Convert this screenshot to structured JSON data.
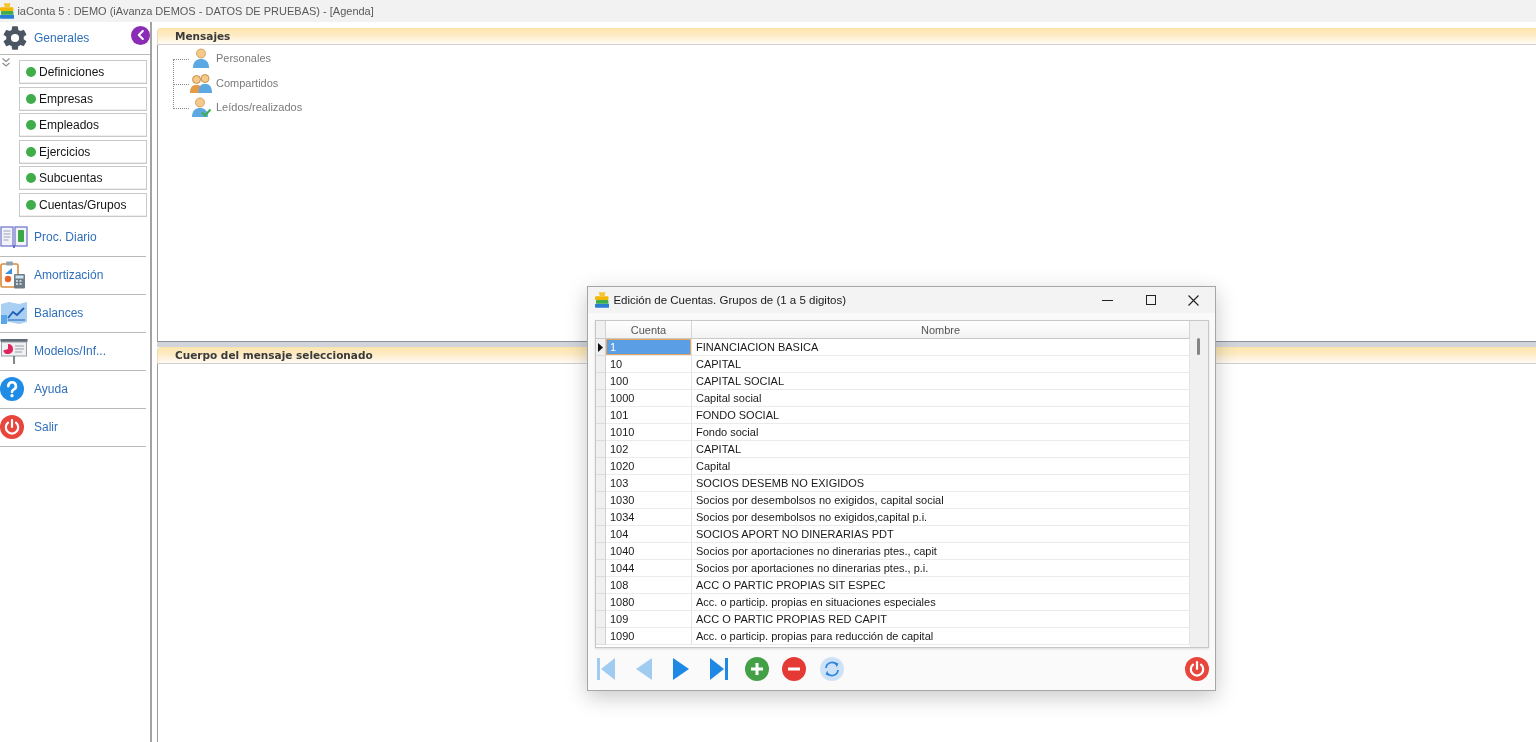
{
  "window": {
    "title": "iaConta 5 : DEMO (iAvanza DEMOS - DATOS DE PRUEBAS) - [Agenda]"
  },
  "sidebar": {
    "groups": [
      {
        "label": "Generales",
        "expanded": true,
        "children": [
          {
            "label": "Definiciones"
          },
          {
            "label": "Empresas"
          },
          {
            "label": "Empleados"
          },
          {
            "label": "Ejercicios"
          },
          {
            "label": "Subcuentas"
          },
          {
            "label": "Cuentas/Grupos"
          }
        ]
      },
      {
        "label": "Proc. Diario",
        "expanded": false
      },
      {
        "label": "Amortización",
        "expanded": false
      },
      {
        "label": "Balances",
        "expanded": false
      },
      {
        "label": "Modelos/Inf...",
        "expanded": false
      },
      {
        "label": "Ayuda",
        "expanded": false
      },
      {
        "label": "Salir",
        "expanded": false
      }
    ]
  },
  "messages_panel": {
    "title": "Mensajes",
    "tree": [
      {
        "label": "Personales"
      },
      {
        "label": "Compartidos"
      },
      {
        "label": "Leídos/realizados"
      }
    ]
  },
  "body_panel": {
    "title": "Cuerpo del mensaje seleccionado"
  },
  "dialog": {
    "title": "Edición de Cuentas. Grupos de (1 a 5 digitos)",
    "table": {
      "columns": [
        "Cuenta",
        "Nombre"
      ],
      "rows": [
        {
          "cells": [
            "1",
            "FINANCIACION BASICA"
          ],
          "selected": true
        },
        {
          "cells": [
            "10",
            "CAPITAL"
          ],
          "selected": false
        },
        {
          "cells": [
            "100",
            "CAPITAL SOCIAL"
          ],
          "selected": false
        },
        {
          "cells": [
            "1000",
            "Capital social"
          ],
          "selected": false
        },
        {
          "cells": [
            "101",
            "FONDO SOCIAL"
          ],
          "selected": false
        },
        {
          "cells": [
            "1010",
            "Fondo social"
          ],
          "selected": false
        },
        {
          "cells": [
            "102",
            "CAPITAL"
          ],
          "selected": false
        },
        {
          "cells": [
            "1020",
            "Capital"
          ],
          "selected": false
        },
        {
          "cells": [
            "103",
            "SOCIOS DESEMB NO EXIGIDOS"
          ],
          "selected": false
        },
        {
          "cells": [
            "1030",
            "Socios por desembolsos no exigidos, capital social"
          ],
          "selected": false
        },
        {
          "cells": [
            "1034",
            "Socios por desembolsos no exigidos,capital p.i."
          ],
          "selected": false
        },
        {
          "cells": [
            "104",
            "SOCIOS APORT NO DINERARIAS PDT"
          ],
          "selected": false
        },
        {
          "cells": [
            "1040",
            "Socios por aportaciones no dinerarias ptes., capit"
          ],
          "selected": false
        },
        {
          "cells": [
            "1044",
            "Socios por aportaciones no dinerarias ptes., p.i."
          ],
          "selected": false
        },
        {
          "cells": [
            "108",
            "ACC O PARTIC PROPIAS SIT ESPEC"
          ],
          "selected": false
        },
        {
          "cells": [
            "1080",
            "Acc. o particip. propias en situaciones especiales"
          ],
          "selected": false
        },
        {
          "cells": [
            "109",
            "ACC O PARTIC PROPIAS RED CAPIT"
          ],
          "selected": false
        },
        {
          "cells": [
            "1090",
            "Acc. o particip. propias para reducción de capital"
          ],
          "selected": false
        }
      ]
    },
    "toolbar": [
      {
        "kind": "first",
        "disabled": true
      },
      {
        "kind": "previous",
        "disabled": true
      },
      {
        "kind": "next",
        "disabled": false
      },
      {
        "kind": "last",
        "disabled": false
      },
      {
        "kind": "add",
        "disabled": false
      },
      {
        "kind": "delete",
        "disabled": false
      },
      {
        "kind": "refresh",
        "disabled": false
      },
      {
        "kind": "exit",
        "disabled": false
      }
    ]
  }
}
